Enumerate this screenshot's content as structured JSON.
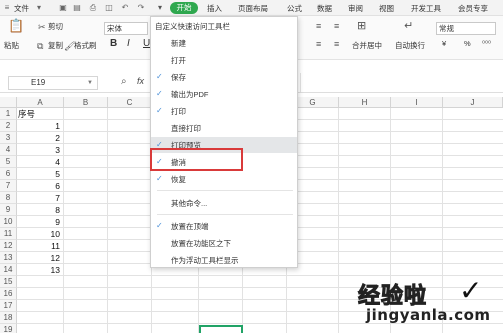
{
  "menubar": {
    "file": "文件",
    "start": "开始",
    "tabs": [
      "插入",
      "页面布局",
      "公式",
      "数据",
      "审阅",
      "视图",
      "开发工具",
      "会员专享"
    ]
  },
  "ribbon": {
    "paste": "粘贴",
    "cut": "剪切",
    "copy": "复制",
    "format_painter": "格式刷",
    "font_name": "宋体",
    "bold": "B",
    "italic": "I",
    "merge_center": "合并居中",
    "auto_wrap": "自动换行",
    "number_format": "常规",
    "currency": "¥",
    "percent": "%"
  },
  "formula_bar": {
    "cell_ref": "E19",
    "fx": "fx"
  },
  "sheet": {
    "columns": [
      "A",
      "B",
      "C",
      "D",
      "E",
      "F",
      "G",
      "H",
      "I",
      "J"
    ],
    "header_cell": "序号",
    "values": [
      "1",
      "2",
      "3",
      "4",
      "5",
      "6",
      "7",
      "8",
      "9",
      "10",
      "11",
      "12",
      "13"
    ],
    "rows": [
      "1",
      "2",
      "3",
      "4",
      "5",
      "6",
      "7",
      "8",
      "9",
      "10",
      "11",
      "12",
      "13",
      "14",
      "15",
      "16",
      "17",
      "18",
      "19"
    ]
  },
  "dropdown": {
    "title": "自定义快速访问工具栏",
    "items": [
      {
        "label": "新建",
        "checked": false
      },
      {
        "label": "打开",
        "checked": false
      },
      {
        "label": "保存",
        "checked": true
      },
      {
        "label": "输出为PDF",
        "checked": true
      },
      {
        "label": "打印",
        "checked": true
      },
      {
        "label": "直接打印",
        "checked": false
      },
      {
        "label": "打印预览",
        "checked": true
      },
      {
        "label": "撤消",
        "checked": true
      },
      {
        "label": "恢复",
        "checked": true
      }
    ],
    "more_commands": "其他命令...",
    "position_items": [
      {
        "label": "放置在顶端",
        "checked": true
      },
      {
        "label": "放置在功能区之下",
        "checked": false
      },
      {
        "label": "作为浮动工具栏显示",
        "checked": false
      }
    ]
  },
  "watermark": {
    "line1": "经验啦",
    "line2": "jingyanla.com"
  },
  "colors": {
    "accent_green": "#2fa84f",
    "highlight_red": "#d93a3a",
    "check_blue": "#4a8fd8"
  }
}
